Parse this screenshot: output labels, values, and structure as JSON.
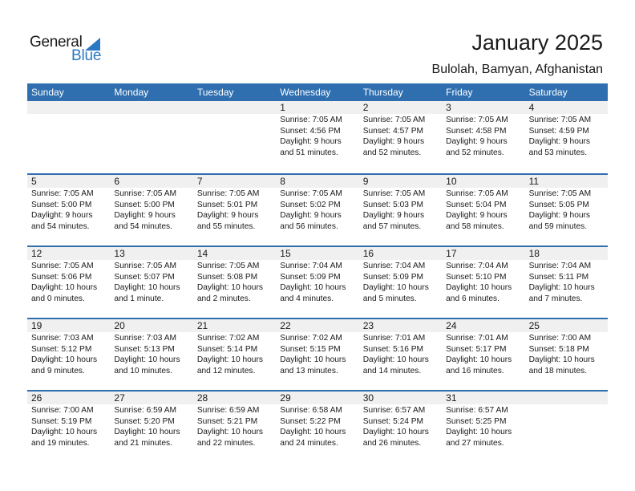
{
  "logo": {
    "line1": "General",
    "line2": "Blue",
    "icon": "triangle-flag-icon",
    "brand_color": "#2b78c2"
  },
  "title": "January 2025",
  "location": "Bulolah, Bamyan, Afghanistan",
  "colors": {
    "header_bg": "#2f6fb0",
    "day_band_bg": "#f0f0f0"
  },
  "weekdays": [
    "Sunday",
    "Monday",
    "Tuesday",
    "Wednesday",
    "Thursday",
    "Friday",
    "Saturday"
  ],
  "weeks": [
    [
      null,
      null,
      null,
      {
        "day": "1",
        "sunrise": "Sunrise: 7:05 AM",
        "sunset": "Sunset: 4:56 PM",
        "daylight1": "Daylight: 9 hours",
        "daylight2": "and 51 minutes."
      },
      {
        "day": "2",
        "sunrise": "Sunrise: 7:05 AM",
        "sunset": "Sunset: 4:57 PM",
        "daylight1": "Daylight: 9 hours",
        "daylight2": "and 52 minutes."
      },
      {
        "day": "3",
        "sunrise": "Sunrise: 7:05 AM",
        "sunset": "Sunset: 4:58 PM",
        "daylight1": "Daylight: 9 hours",
        "daylight2": "and 52 minutes."
      },
      {
        "day": "4",
        "sunrise": "Sunrise: 7:05 AM",
        "sunset": "Sunset: 4:59 PM",
        "daylight1": "Daylight: 9 hours",
        "daylight2": "and 53 minutes."
      }
    ],
    [
      {
        "day": "5",
        "sunrise": "Sunrise: 7:05 AM",
        "sunset": "Sunset: 5:00 PM",
        "daylight1": "Daylight: 9 hours",
        "daylight2": "and 54 minutes."
      },
      {
        "day": "6",
        "sunrise": "Sunrise: 7:05 AM",
        "sunset": "Sunset: 5:00 PM",
        "daylight1": "Daylight: 9 hours",
        "daylight2": "and 54 minutes."
      },
      {
        "day": "7",
        "sunrise": "Sunrise: 7:05 AM",
        "sunset": "Sunset: 5:01 PM",
        "daylight1": "Daylight: 9 hours",
        "daylight2": "and 55 minutes."
      },
      {
        "day": "8",
        "sunrise": "Sunrise: 7:05 AM",
        "sunset": "Sunset: 5:02 PM",
        "daylight1": "Daylight: 9 hours",
        "daylight2": "and 56 minutes."
      },
      {
        "day": "9",
        "sunrise": "Sunrise: 7:05 AM",
        "sunset": "Sunset: 5:03 PM",
        "daylight1": "Daylight: 9 hours",
        "daylight2": "and 57 minutes."
      },
      {
        "day": "10",
        "sunrise": "Sunrise: 7:05 AM",
        "sunset": "Sunset: 5:04 PM",
        "daylight1": "Daylight: 9 hours",
        "daylight2": "and 58 minutes."
      },
      {
        "day": "11",
        "sunrise": "Sunrise: 7:05 AM",
        "sunset": "Sunset: 5:05 PM",
        "daylight1": "Daylight: 9 hours",
        "daylight2": "and 59 minutes."
      }
    ],
    [
      {
        "day": "12",
        "sunrise": "Sunrise: 7:05 AM",
        "sunset": "Sunset: 5:06 PM",
        "daylight1": "Daylight: 10 hours",
        "daylight2": "and 0 minutes."
      },
      {
        "day": "13",
        "sunrise": "Sunrise: 7:05 AM",
        "sunset": "Sunset: 5:07 PM",
        "daylight1": "Daylight: 10 hours",
        "daylight2": "and 1 minute."
      },
      {
        "day": "14",
        "sunrise": "Sunrise: 7:05 AM",
        "sunset": "Sunset: 5:08 PM",
        "daylight1": "Daylight: 10 hours",
        "daylight2": "and 2 minutes."
      },
      {
        "day": "15",
        "sunrise": "Sunrise: 7:04 AM",
        "sunset": "Sunset: 5:09 PM",
        "daylight1": "Daylight: 10 hours",
        "daylight2": "and 4 minutes."
      },
      {
        "day": "16",
        "sunrise": "Sunrise: 7:04 AM",
        "sunset": "Sunset: 5:09 PM",
        "daylight1": "Daylight: 10 hours",
        "daylight2": "and 5 minutes."
      },
      {
        "day": "17",
        "sunrise": "Sunrise: 7:04 AM",
        "sunset": "Sunset: 5:10 PM",
        "daylight1": "Daylight: 10 hours",
        "daylight2": "and 6 minutes."
      },
      {
        "day": "18",
        "sunrise": "Sunrise: 7:04 AM",
        "sunset": "Sunset: 5:11 PM",
        "daylight1": "Daylight: 10 hours",
        "daylight2": "and 7 minutes."
      }
    ],
    [
      {
        "day": "19",
        "sunrise": "Sunrise: 7:03 AM",
        "sunset": "Sunset: 5:12 PM",
        "daylight1": "Daylight: 10 hours",
        "daylight2": "and 9 minutes."
      },
      {
        "day": "20",
        "sunrise": "Sunrise: 7:03 AM",
        "sunset": "Sunset: 5:13 PM",
        "daylight1": "Daylight: 10 hours",
        "daylight2": "and 10 minutes."
      },
      {
        "day": "21",
        "sunrise": "Sunrise: 7:02 AM",
        "sunset": "Sunset: 5:14 PM",
        "daylight1": "Daylight: 10 hours",
        "daylight2": "and 12 minutes."
      },
      {
        "day": "22",
        "sunrise": "Sunrise: 7:02 AM",
        "sunset": "Sunset: 5:15 PM",
        "daylight1": "Daylight: 10 hours",
        "daylight2": "and 13 minutes."
      },
      {
        "day": "23",
        "sunrise": "Sunrise: 7:01 AM",
        "sunset": "Sunset: 5:16 PM",
        "daylight1": "Daylight: 10 hours",
        "daylight2": "and 14 minutes."
      },
      {
        "day": "24",
        "sunrise": "Sunrise: 7:01 AM",
        "sunset": "Sunset: 5:17 PM",
        "daylight1": "Daylight: 10 hours",
        "daylight2": "and 16 minutes."
      },
      {
        "day": "25",
        "sunrise": "Sunrise: 7:00 AM",
        "sunset": "Sunset: 5:18 PM",
        "daylight1": "Daylight: 10 hours",
        "daylight2": "and 18 minutes."
      }
    ],
    [
      {
        "day": "26",
        "sunrise": "Sunrise: 7:00 AM",
        "sunset": "Sunset: 5:19 PM",
        "daylight1": "Daylight: 10 hours",
        "daylight2": "and 19 minutes."
      },
      {
        "day": "27",
        "sunrise": "Sunrise: 6:59 AM",
        "sunset": "Sunset: 5:20 PM",
        "daylight1": "Daylight: 10 hours",
        "daylight2": "and 21 minutes."
      },
      {
        "day": "28",
        "sunrise": "Sunrise: 6:59 AM",
        "sunset": "Sunset: 5:21 PM",
        "daylight1": "Daylight: 10 hours",
        "daylight2": "and 22 minutes."
      },
      {
        "day": "29",
        "sunrise": "Sunrise: 6:58 AM",
        "sunset": "Sunset: 5:22 PM",
        "daylight1": "Daylight: 10 hours",
        "daylight2": "and 24 minutes."
      },
      {
        "day": "30",
        "sunrise": "Sunrise: 6:57 AM",
        "sunset": "Sunset: 5:24 PM",
        "daylight1": "Daylight: 10 hours",
        "daylight2": "and 26 minutes."
      },
      {
        "day": "31",
        "sunrise": "Sunrise: 6:57 AM",
        "sunset": "Sunset: 5:25 PM",
        "daylight1": "Daylight: 10 hours",
        "daylight2": "and 27 minutes."
      },
      null
    ]
  ]
}
